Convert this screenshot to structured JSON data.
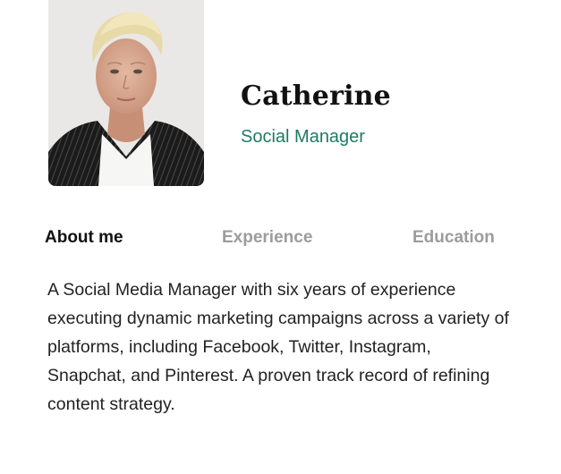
{
  "profile": {
    "name": "Catherine",
    "role": "Social Manager",
    "accent_color": "#1f7a66"
  },
  "tabs": [
    {
      "label": "About me",
      "active": true
    },
    {
      "label": "Experience",
      "active": false
    },
    {
      "label": "Education",
      "active": false
    }
  ],
  "about": {
    "text": "A Social Media Manager with six years of experience executing dynamic marketing campaigns across a variety of platforms, including Facebook, Twitter, Instagram, Snapchat, and Pinterest. A proven track record of refining content strategy."
  }
}
